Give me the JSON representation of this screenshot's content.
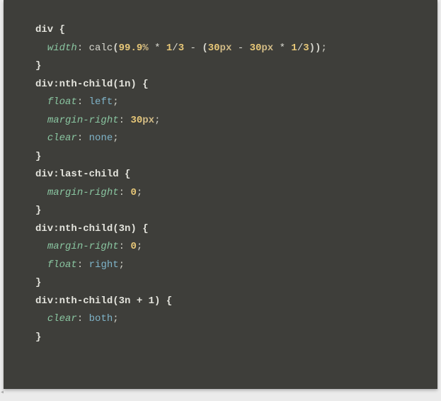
{
  "code": {
    "rules": [
      {
        "selector": {
          "tag": "div",
          "pseudo": ""
        },
        "decls": [
          {
            "prop": "width",
            "fn": "calc",
            "expr": [
              {
                "num": "99.9%"
              },
              {
                "op": " * "
              },
              {
                "num": "1"
              },
              {
                "op": "/"
              },
              {
                "num": "3"
              },
              {
                "op": " - "
              },
              {
                "lp": "("
              },
              {
                "num": "30px"
              },
              {
                "op": " - "
              },
              {
                "num": "30px"
              },
              {
                "op": " * "
              },
              {
                "num": "1"
              },
              {
                "op": "/"
              },
              {
                "num": "3"
              },
              {
                "rp": ")"
              }
            ]
          }
        ]
      },
      {
        "selector": {
          "tag": "div",
          "pseudo": ":nth-child(1n)"
        },
        "decls": [
          {
            "prop": "float",
            "kw": "left"
          },
          {
            "prop": "margin-right",
            "num": "30px"
          },
          {
            "prop": "clear",
            "kw": "none"
          }
        ]
      },
      {
        "selector": {
          "tag": "div",
          "pseudo": ":last-child"
        },
        "decls": [
          {
            "prop": "margin-right",
            "num": "0"
          }
        ]
      },
      {
        "selector": {
          "tag": "div",
          "pseudo": ":nth-child(3n)"
        },
        "decls": [
          {
            "prop": "margin-right",
            "num": "0"
          },
          {
            "prop": "float",
            "kw": "right"
          }
        ]
      },
      {
        "selector": {
          "tag": "div",
          "pseudo": ":nth-child(3n + 1)"
        },
        "decls": [
          {
            "prop": "clear",
            "kw": "both"
          }
        ]
      }
    ]
  },
  "scrollGlyph": "◂"
}
